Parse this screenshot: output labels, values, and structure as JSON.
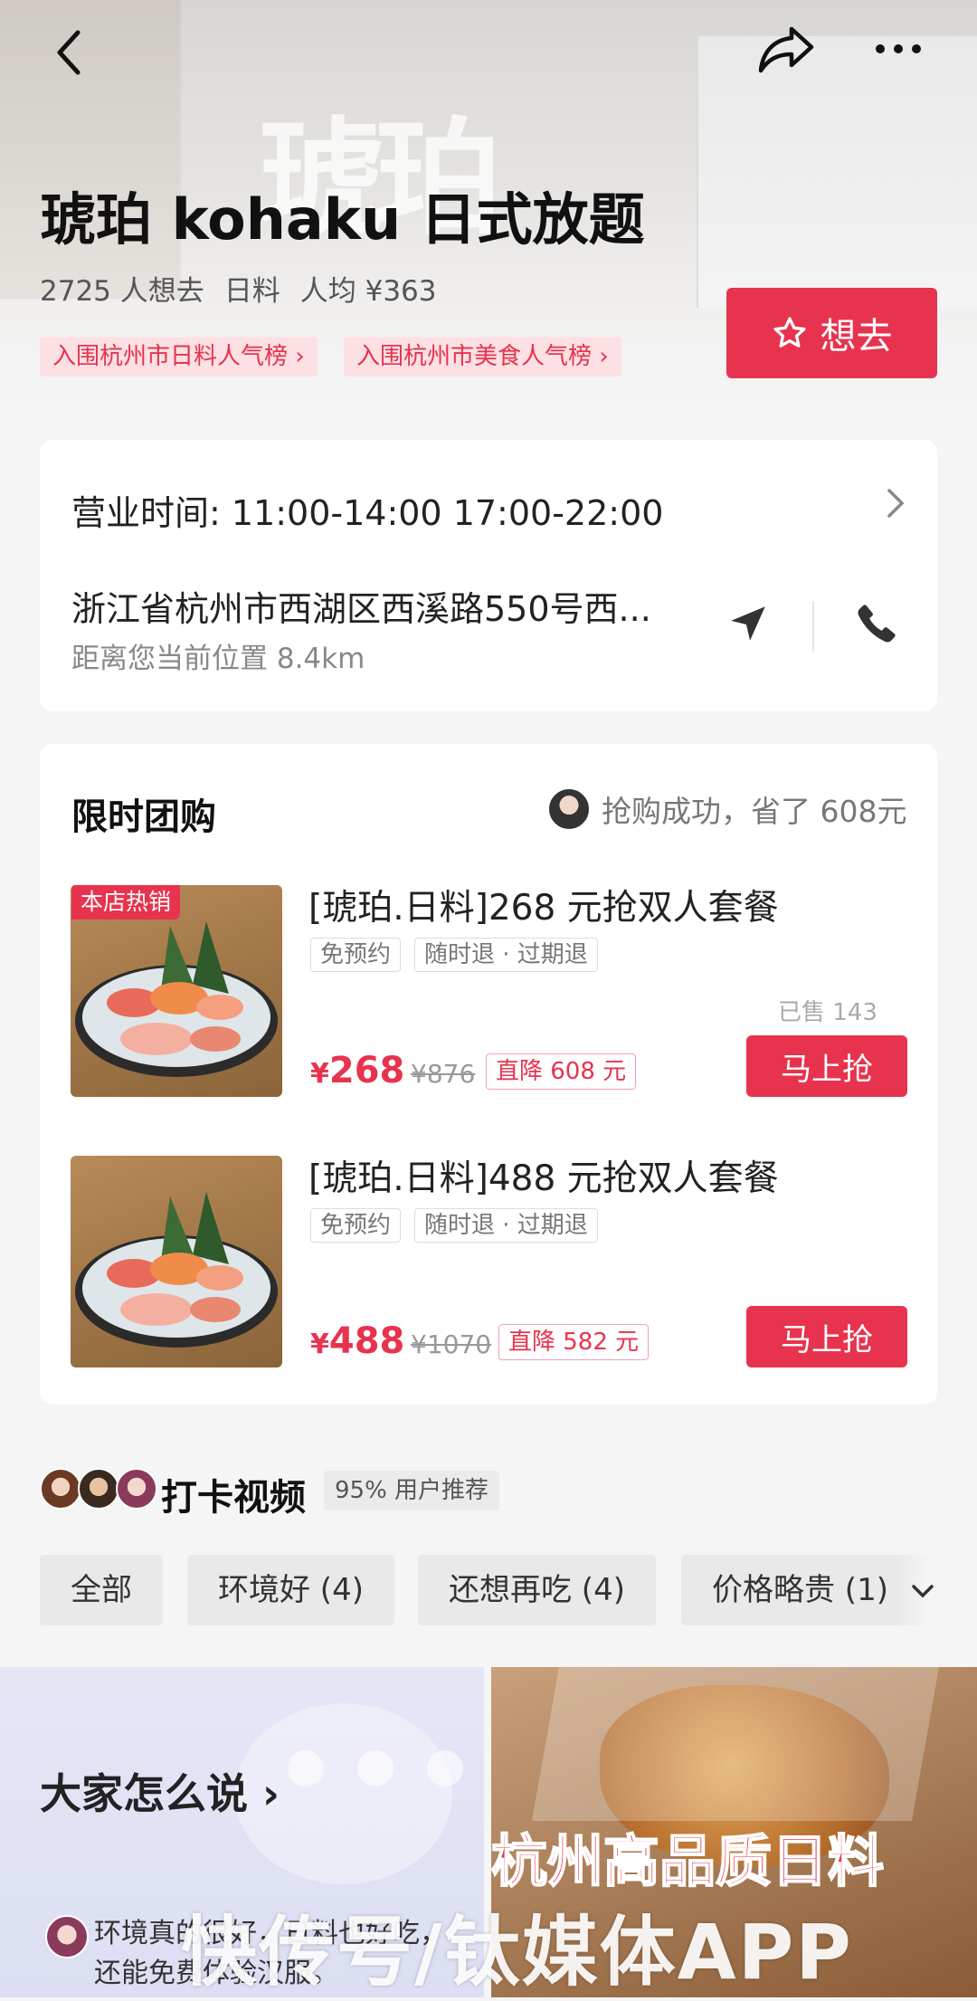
{
  "header": {
    "logo_text": "琥珀",
    "title": "琥珀 kohaku 日式放题",
    "want_count": "2725 人想去",
    "category": "日料",
    "avg_price": "人均 ¥363",
    "rank_tags": [
      "入围杭州市日料人气榜 ›",
      "入围杭州市美食人气榜 ›"
    ],
    "want_button": "想去"
  },
  "info": {
    "hours": "营业时间: 11:00-14:00 17:00-22:00",
    "address": "浙江省杭州市西湖区西溪路550号西...",
    "distance": "距离您当前位置 8.4km"
  },
  "deals": {
    "section_title": "限时团购",
    "notice": "抢购成功，省了 608元",
    "hot_tag": "本店热销",
    "items": [
      {
        "name": "[琥珀.日料]268 元抢双人套餐",
        "tags": [
          "免预约",
          "随时退 · 过期退"
        ],
        "sold": "已售 143",
        "currency": "¥",
        "price": "268",
        "original": "¥876",
        "discount": "直降 608 元",
        "button": "马上抢"
      },
      {
        "name": "[琥珀.日料]488 元抢双人套餐",
        "tags": [
          "免预约",
          "随时退 · 过期退"
        ],
        "currency": "¥",
        "price": "488",
        "original": "¥1070",
        "discount": "直降 582 元",
        "button": "马上抢"
      }
    ]
  },
  "checkin": {
    "title": "打卡视频",
    "badge": "95% 用户推荐",
    "filters": [
      "全部",
      "环境好 (4)",
      "还想再吃 (4)",
      "价格略贵 (1)"
    ]
  },
  "videos": {
    "left_title": "大家怎么说 ›",
    "comment": "环境真的很好，日料也好吃，还能免费体验汉服。",
    "right_overlay": "杭州高品质日料"
  },
  "watermark": "快传号/钛媒体APP",
  "colors": {
    "accent": "#e8334e",
    "tag_bg": "#fde0e4"
  }
}
